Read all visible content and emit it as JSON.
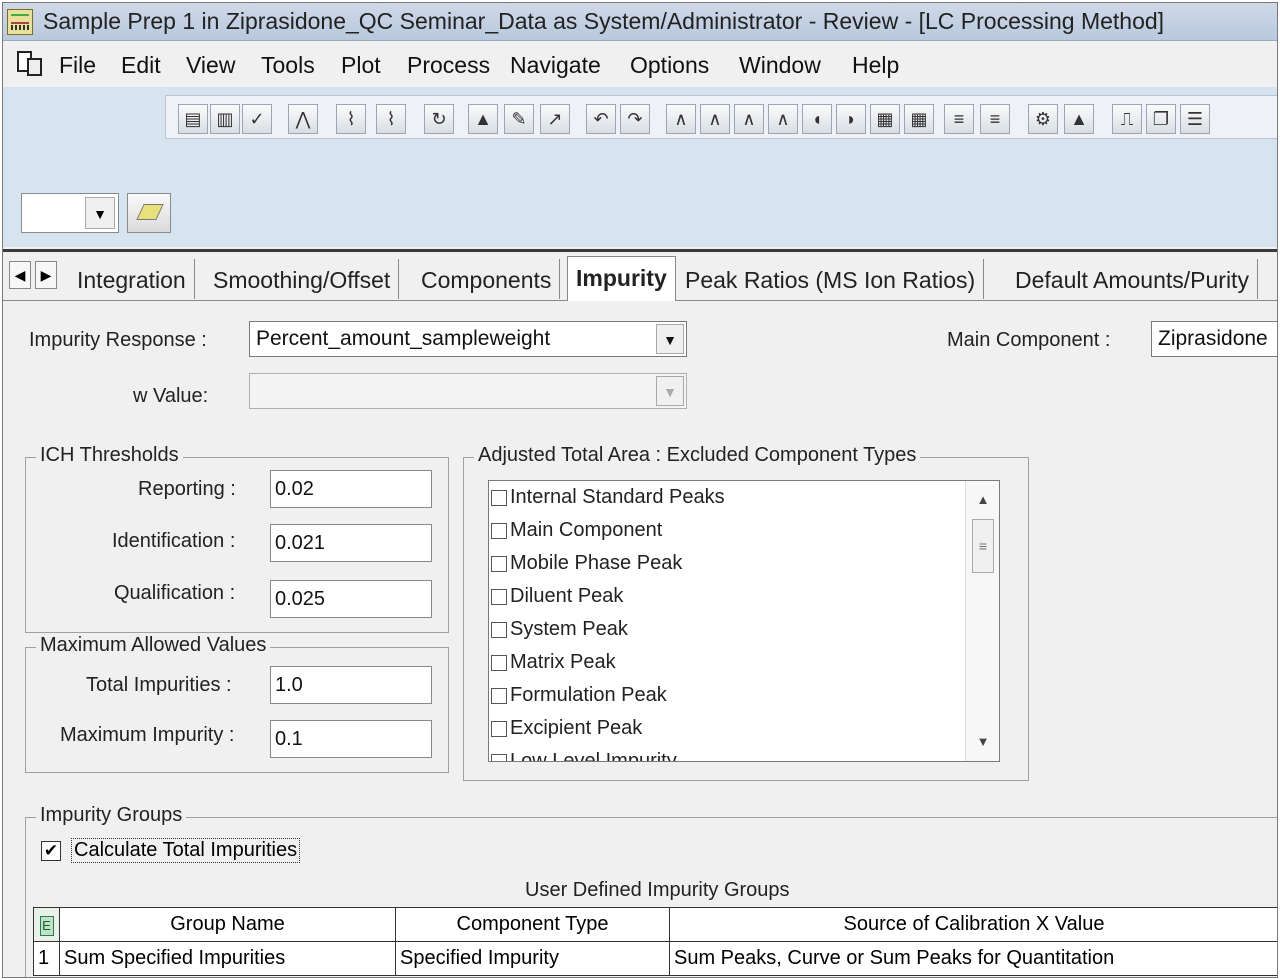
{
  "window": {
    "title": "Sample Prep 1 in Ziprasidone_QC Seminar_Data as System/Administrator - Review - [LC Processing Method]"
  },
  "menu": {
    "items": [
      "File",
      "Edit",
      "View",
      "Tools",
      "Plot",
      "Process",
      "Navigate",
      "Options",
      "Window",
      "Help"
    ]
  },
  "toolbar": {
    "combo_value": "",
    "icons": [
      "view-icon",
      "edit-icon",
      "check-icon",
      "chart-icon",
      "peak-icon",
      "peak2-icon",
      "refresh-icon",
      "chromatogram-icon",
      "marker-icon",
      "scale-icon",
      "undo-icon",
      "redo-icon",
      "integrate1-icon",
      "integrate2-icon",
      "integrate3-icon",
      "integrate4-icon",
      "split-icon",
      "merge-icon",
      "window1-icon",
      "window2-icon",
      "list1-icon",
      "list2-icon",
      "calibrate-icon",
      "quantitate-icon",
      "plot-icon",
      "copy-icon"
    ]
  },
  "tabs": {
    "items": [
      "Integration",
      "Smoothing/Offset",
      "Components",
      "Impurity",
      "Peak Ratios (MS Ion Ratios)",
      "Default Amounts/Purity"
    ],
    "active": "Impurity"
  },
  "impurity": {
    "response_label": "Impurity Response :",
    "response_value": "Percent_amount_sampleweight",
    "w_value_label": "w Value:",
    "w_value": "",
    "main_component_label": "Main Component :",
    "main_component_value": "Ziprasidone"
  },
  "ich": {
    "title": "ICH Thresholds",
    "reporting_label": "Reporting :",
    "reporting_value": "0.02",
    "identification_label": "Identification :",
    "identification_value": "0.021",
    "qualification_label": "Qualification :",
    "qualification_value": "0.025"
  },
  "max_allowed": {
    "title": "Maximum Allowed Values",
    "total_label": "Total Impurities :",
    "total_value": "1.0",
    "max_label": "Maximum Impurity :",
    "max_value": "0.1"
  },
  "adjusted": {
    "title": "Adjusted Total Area : Excluded Component Types",
    "items": [
      "Internal Standard Peaks",
      "Main Component",
      "Mobile Phase Peak",
      "Diluent Peak",
      "System Peak",
      "Matrix Peak",
      "Formulation Peak",
      "Excipient Peak",
      "Low Level Impurity"
    ]
  },
  "groups": {
    "title": "Impurity Groups",
    "calc_label": "Calculate Total Impurities",
    "calc_checked": true,
    "table_caption": "User Defined Impurity Groups",
    "columns": [
      "Group Name",
      "Component Type",
      "Source of Calibration X Value"
    ],
    "rows": [
      {
        "num": "1",
        "group": "Sum Specified Impurities",
        "type": "Specified Impurity",
        "source": "Sum Peaks, Curve or Sum Peaks for Quantitation"
      }
    ]
  }
}
